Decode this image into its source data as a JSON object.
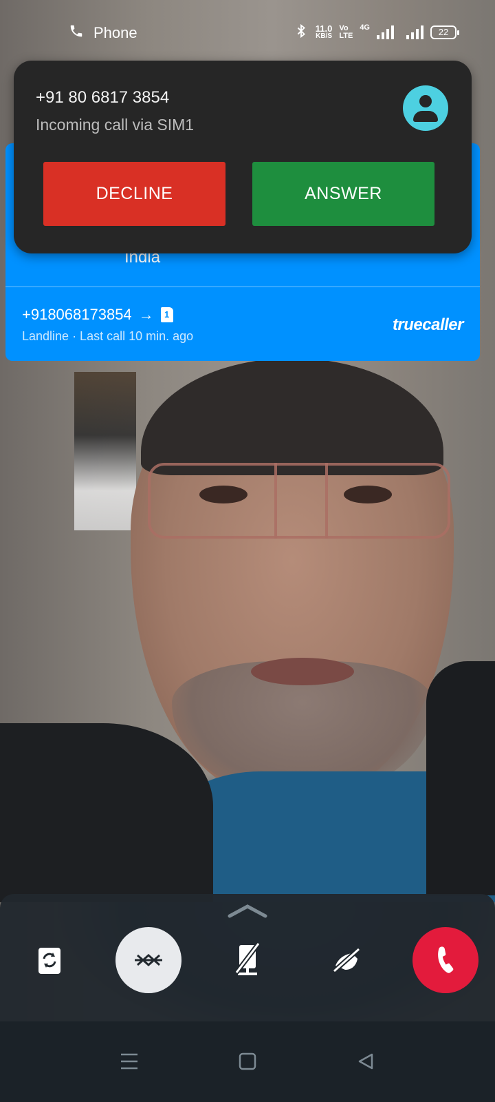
{
  "status_bar": {
    "app_name": "Phone",
    "app_icon": "phone-icon",
    "net_speed_value": "11.0",
    "net_speed_unit": "KB/S",
    "volte_top": "Vo",
    "volte_bottom": "LTE",
    "network_type": "4G",
    "battery": "22"
  },
  "truecaller": {
    "location": "India",
    "number": "+918068173854",
    "arrow": "→",
    "sim": "1",
    "subtitle": "Landline · Last call 10 min. ago",
    "brand": "truecaller",
    "color": "#0091ff"
  },
  "incoming_call": {
    "number": "+91 80 6817 3854",
    "subtitle": "Incoming call via SIM1",
    "decline_label": "DECLINE",
    "answer_label": "ANSWER",
    "decline_color": "#d93025",
    "answer_color": "#1e8e3e"
  },
  "controls": {
    "items": [
      {
        "icon": "switch-camera-icon"
      },
      {
        "icon": "bluetooth-off-icon"
      },
      {
        "icon": "mic-off-icon"
      },
      {
        "icon": "video-off-icon"
      },
      {
        "icon": "end-call-icon",
        "color": "#e31b3c"
      }
    ]
  },
  "nav": {
    "items": [
      {
        "icon": "menu-icon"
      },
      {
        "icon": "home-icon"
      },
      {
        "icon": "back-icon"
      }
    ]
  }
}
